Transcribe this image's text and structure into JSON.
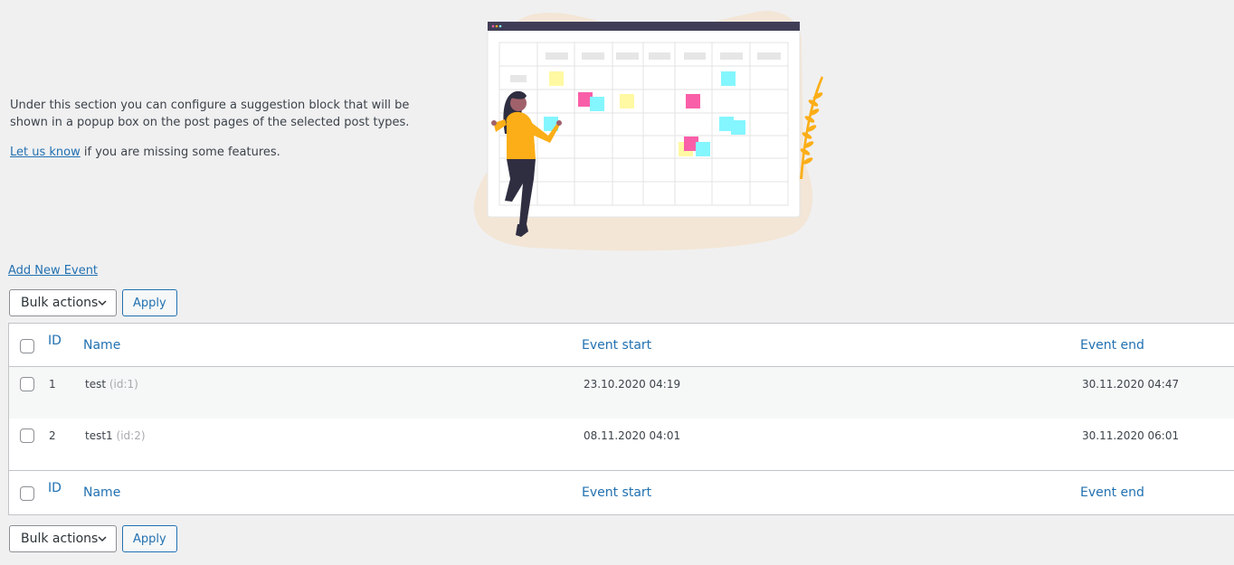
{
  "intro": {
    "description": "Under this section you can configure a suggestion block that will be shown in a popup box on the post pages of the selected post types.",
    "feedback_link": "Let us know",
    "feedback_rest": " if you are missing some features."
  },
  "add_new_label": "Add New Event",
  "bulk": {
    "select_value": "Bulk actions",
    "apply_label": "Apply"
  },
  "table": {
    "columns": {
      "id": "ID",
      "name": "Name",
      "start": "Event start",
      "end": "Event end"
    },
    "rows": [
      {
        "id": "1",
        "name": "test",
        "slug": "(id:1)",
        "start": "23.10.2020 04:19",
        "end": "30.11.2020 04:47"
      },
      {
        "id": "2",
        "name": "test1",
        "slug": "(id:2)",
        "start": "08.11.2020 04:01",
        "end": "30.11.2020 06:01"
      }
    ]
  },
  "colors": {
    "accent": "#2271b1",
    "background": "#f0f0f1",
    "illustration_person": "#fbae17",
    "note_pink": "#f95fa8",
    "note_cyan": "#84f6ff",
    "note_yellow": "#fff9a3"
  }
}
